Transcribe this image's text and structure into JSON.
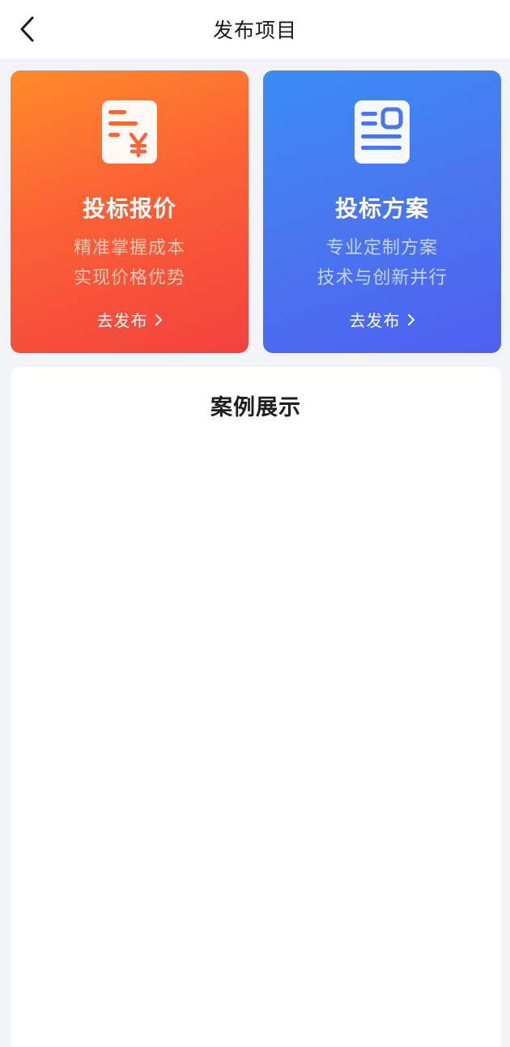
{
  "header": {
    "title": "发布项目",
    "back_icon": "chevron-left-icon"
  },
  "cards": [
    {
      "title": "投标报价",
      "desc_line1": "精准掌握成本",
      "desc_line2": "实现价格优势",
      "action_label": "去发布",
      "icon": "price-document-icon",
      "color": "#f65a36"
    },
    {
      "title": "投标方案",
      "desc_line1": "专业定制方案",
      "desc_line2": "技术与创新并行",
      "action_label": "去发布",
      "icon": "plan-document-icon",
      "color": "#4a74f0"
    }
  ],
  "cases": {
    "title": "案例展示"
  }
}
